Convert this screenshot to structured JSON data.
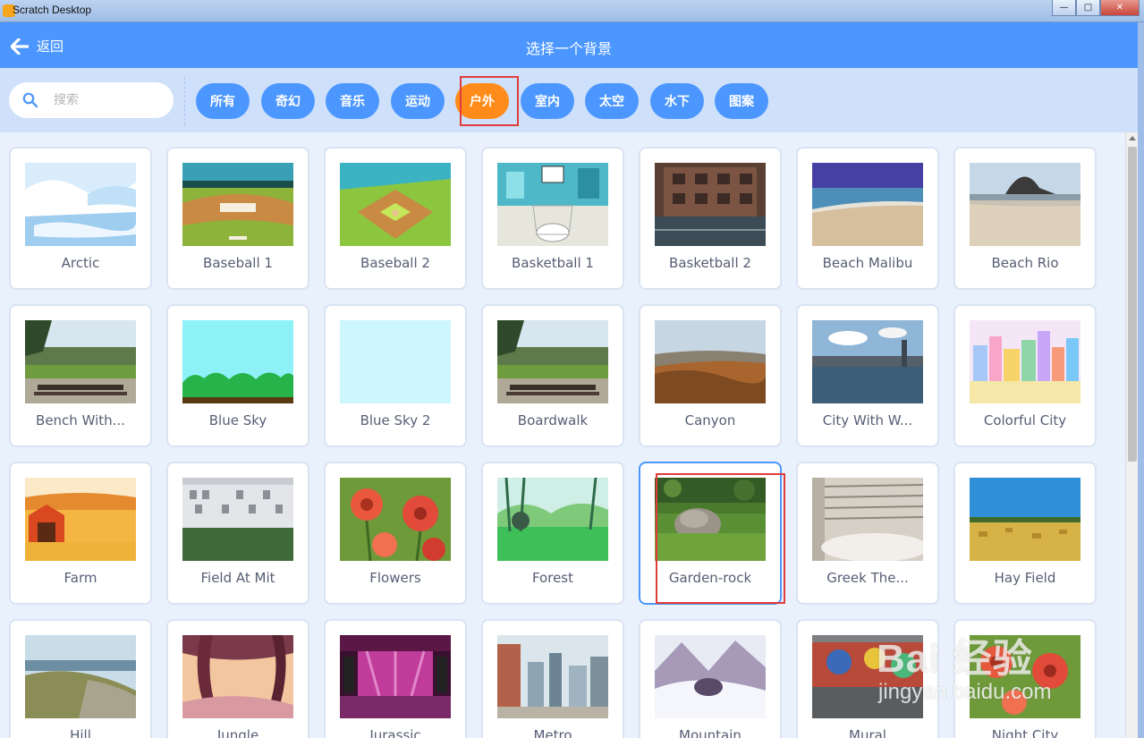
{
  "window": {
    "title": "Scratch Desktop",
    "minimize": "—",
    "maximize": "□",
    "close": "✕"
  },
  "header": {
    "back_label": "返回",
    "title": "选择一个背景"
  },
  "search": {
    "placeholder": "搜索",
    "value": ""
  },
  "tags": [
    {
      "label": "所有",
      "active": false
    },
    {
      "label": "奇幻",
      "active": false
    },
    {
      "label": "音乐",
      "active": false
    },
    {
      "label": "运动",
      "active": false
    },
    {
      "label": "户外",
      "active": true
    },
    {
      "label": "室内",
      "active": false
    },
    {
      "label": "太空",
      "active": false
    },
    {
      "label": "水下",
      "active": false
    },
    {
      "label": "图案",
      "active": false
    }
  ],
  "backdrops": [
    {
      "label": "Arctic",
      "icon": "arctic-thumbnail"
    },
    {
      "label": "Baseball 1",
      "icon": "baseball-thumbnail"
    },
    {
      "label": "Baseball 2",
      "icon": "baseball-field-thumbnail"
    },
    {
      "label": "Basketball 1",
      "icon": "basketball-court-thumbnail"
    },
    {
      "label": "Basketball 2",
      "icon": "basketball-photo-thumbnail"
    },
    {
      "label": "Beach Malibu",
      "icon": "beach-thumbnail"
    },
    {
      "label": "Beach Rio",
      "icon": "beach-mountain-thumbnail"
    },
    {
      "label": "Bench With...",
      "icon": "bench-thumbnail"
    },
    {
      "label": "Blue Sky",
      "icon": "sky-hills-thumbnail"
    },
    {
      "label": "Blue Sky 2",
      "icon": "plain-sky-thumbnail"
    },
    {
      "label": "Boardwalk",
      "icon": "bench-thumbnail"
    },
    {
      "label": "Canyon",
      "icon": "canyon-thumbnail"
    },
    {
      "label": "City With W...",
      "icon": "city-water-thumbnail"
    },
    {
      "label": "Colorful City",
      "icon": "colorful-city-thumbnail"
    },
    {
      "label": "Farm",
      "icon": "farm-thumbnail"
    },
    {
      "label": "Field At Mit",
      "icon": "field-building-thumbnail"
    },
    {
      "label": "Flowers",
      "icon": "flowers-thumbnail"
    },
    {
      "label": "Forest",
      "icon": "forest-thumbnail"
    },
    {
      "label": "Garden-rock",
      "icon": "rock-thumbnail",
      "selected": true
    },
    {
      "label": "Greek The...",
      "icon": "theater-thumbnail"
    },
    {
      "label": "Hay Field",
      "icon": "hay-field-thumbnail"
    },
    {
      "label": "Hill",
      "icon": "hill-thumbnail"
    },
    {
      "label": "Jungle",
      "icon": "jungle-thumbnail"
    },
    {
      "label": "Jurassic",
      "icon": "stage-thumbnail"
    },
    {
      "label": "Metro",
      "icon": "metro-thumbnail"
    },
    {
      "label": "Mountain",
      "icon": "snow-mountain-thumbnail"
    },
    {
      "label": "Mural",
      "icon": "mural-thumbnail"
    },
    {
      "label": "Night City",
      "icon": "flowers-thumbnail"
    }
  ],
  "watermark": {
    "logo": "Bai 经验",
    "url": "jingyan.baidu.com"
  },
  "colors": {
    "header": "#4c97ff",
    "accent": "#ff8c1a",
    "highlight": "#e03c3c"
  }
}
